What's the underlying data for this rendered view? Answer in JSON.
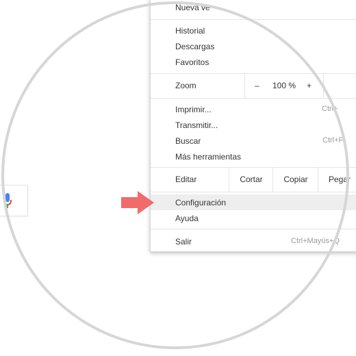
{
  "menu": {
    "partial_top_item": "Nueva ve",
    "group1": [
      "Historial",
      "Descargas",
      "Favoritos"
    ],
    "zoom": {
      "label": "Zoom",
      "minus": "–",
      "value": "100 %",
      "plus": "+"
    },
    "group2": [
      {
        "label": "Imprimir...",
        "shortcut": "Ctrl+"
      },
      {
        "label": "Transmitir...",
        "shortcut": ""
      },
      {
        "label": "Buscar",
        "shortcut": "Ctrl+F"
      },
      {
        "label": "Más herramientas",
        "shortcut": ""
      }
    ],
    "edit": {
      "label": "Editar",
      "cut": "Cortar",
      "copy": "Copiar",
      "paste": "Pegar"
    },
    "settings": "Configuración",
    "help": "Ayuda",
    "exit": {
      "label": "Salir",
      "shortcut": "Ctrl+Mayús+Q"
    }
  },
  "colors": {
    "arrow": "#f16b6b",
    "ring": "#d6d6d6",
    "highlight": "#eeeeee"
  },
  "icons": {
    "mic": "microphone-icon"
  }
}
